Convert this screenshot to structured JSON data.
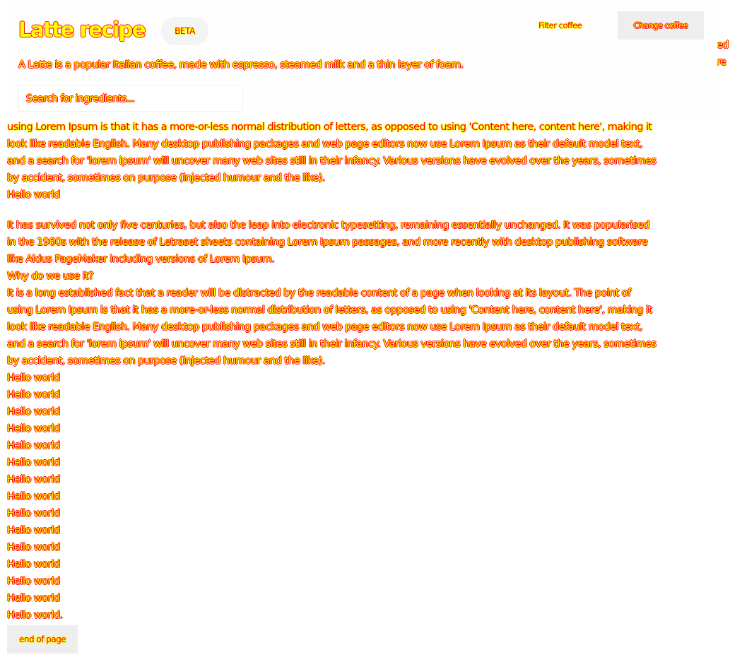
{
  "colors": {
    "text_yellow": "#ffff00",
    "text_red": "#ff0000",
    "button_bg": "#eeeeee",
    "header_bg": "#fefefe",
    "badge_bg": "#f4f4f4"
  },
  "header": {
    "title": "Latte recipe",
    "badge": "BETA",
    "filter_link": "Filter coffee",
    "change_button": "Change coffee",
    "description": "A Latte is a popular Italian coffee, made with espresso, steamed milk and a thin layer of foam.",
    "search_placeholder": "Search for ingredients..."
  },
  "peek": {
    "line1": "ed",
    "line2": "re"
  },
  "content": {
    "block1": {
      "line1": "using Lorem Ipsum is that it has a more-or-less normal distribution of letters, as opposed to using 'Content here, content here', making it",
      "line2": "look like readable English. Many desktop publishing packages and web page editors now use Lorem Ipsum as their default model text,",
      "line3": "and a search for 'lorem ipsum' will uncover many web sites still in their infancy. Various versions have evolved over the years, sometimes",
      "line4": "by accident, sometimes on purpose (injected humour and the like).",
      "hello": "Hello world"
    },
    "block2": {
      "line1": "It has survived not only five centuries, but also the leap into electronic typesetting, remaining essentially unchanged. It was popularised",
      "line2": "in the 1960s with the release of Letraset sheets containing Lorem Ipsum passages, and more recently with desktop publishing software",
      "line3": "like Aldus PageMaker including versions of Lorem Ipsum.",
      "question": "Why do we use it?",
      "line4": "It is a long established fact that a reader will be distracted by the readable content of a page when looking at its layout. The point of",
      "line5": "using Lorem Ipsum is that it has a more-or-less normal distribution of letters, as opposed to using 'Content here, content here', making it",
      "line6": "look like readable English. Many desktop publishing packages and web page editors now use Lorem Ipsum as their default model text,",
      "line7": "and a search for 'lorem ipsum' will uncover many web sites still in their infancy. Various versions have evolved over the years, sometimes",
      "line8": "by accident, sometimes on purpose (injected humour and the like)."
    },
    "hello_lines": [
      "Hello world",
      "Hello world",
      "Hello world",
      "Hello world",
      "Hello world",
      "Hello world",
      "Hello world",
      "Hello world",
      "Hello world",
      "Hello world",
      "Hello world",
      "Hello world",
      "Hello world",
      "Hello world",
      "Hello world."
    ],
    "end_button": "end of page"
  }
}
